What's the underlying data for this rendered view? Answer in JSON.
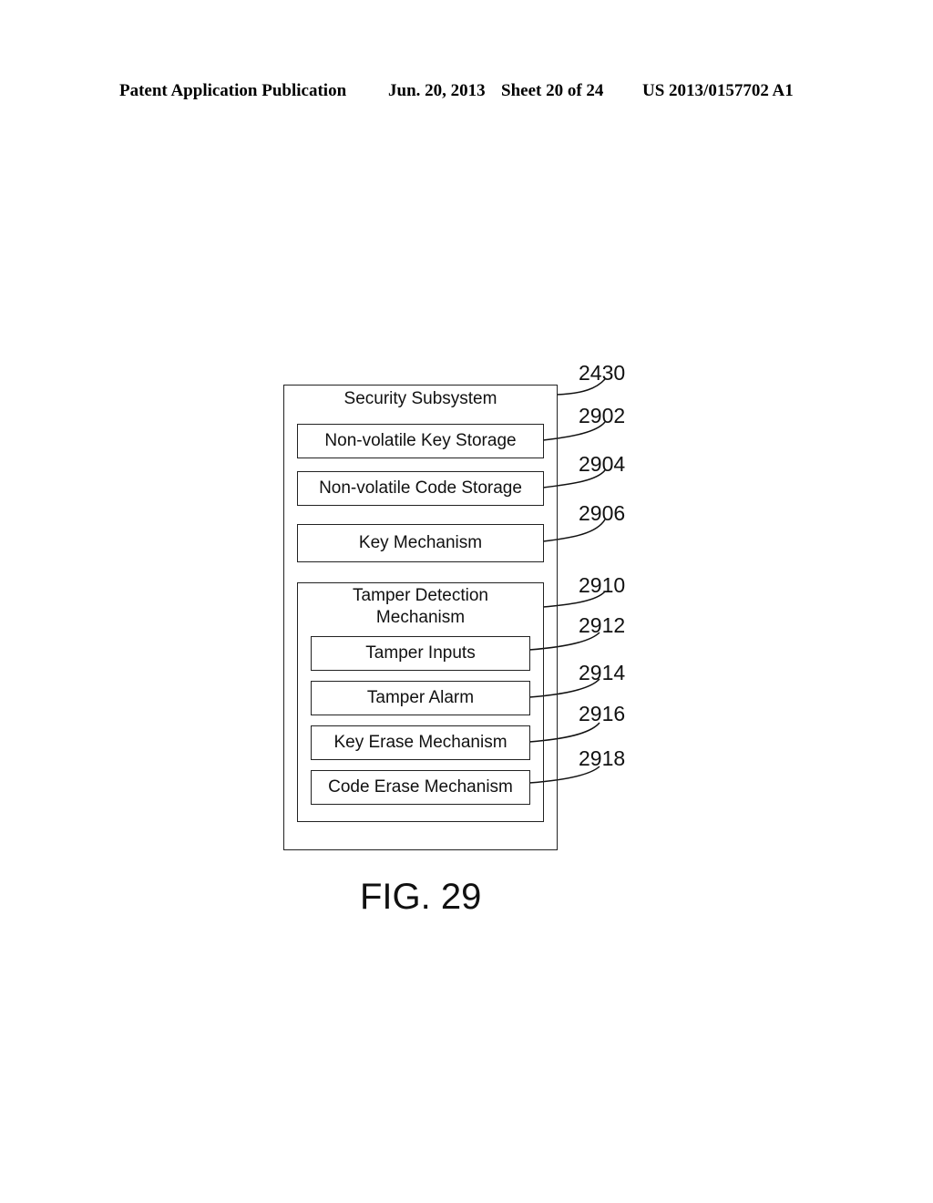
{
  "header": {
    "publication": "Patent Application Publication",
    "date": "Jun. 20, 2013",
    "sheet": "Sheet 20 of 24",
    "number": "US 2013/0157702 A1"
  },
  "diagram": {
    "outer": {
      "label": "Security Subsystem",
      "ref": "2430"
    },
    "blocks": [
      {
        "label": "Non-volatile Key Storage",
        "ref": "2902"
      },
      {
        "label": "Non-volatile Code Storage",
        "ref": "2904"
      },
      {
        "label": "Key Mechanism",
        "ref": "2906"
      }
    ],
    "tamper": {
      "label_line1": "Tamper Detection",
      "label_line2": "Mechanism",
      "ref": "2910",
      "items": [
        {
          "label": "Tamper Inputs",
          "ref": "2912"
        },
        {
          "label": "Tamper Alarm",
          "ref": "2914"
        },
        {
          "label": "Key Erase Mechanism",
          "ref": "2916"
        },
        {
          "label": "Code Erase Mechanism",
          "ref": "2918"
        }
      ]
    }
  },
  "figure": {
    "caption": "FIG. 29"
  }
}
